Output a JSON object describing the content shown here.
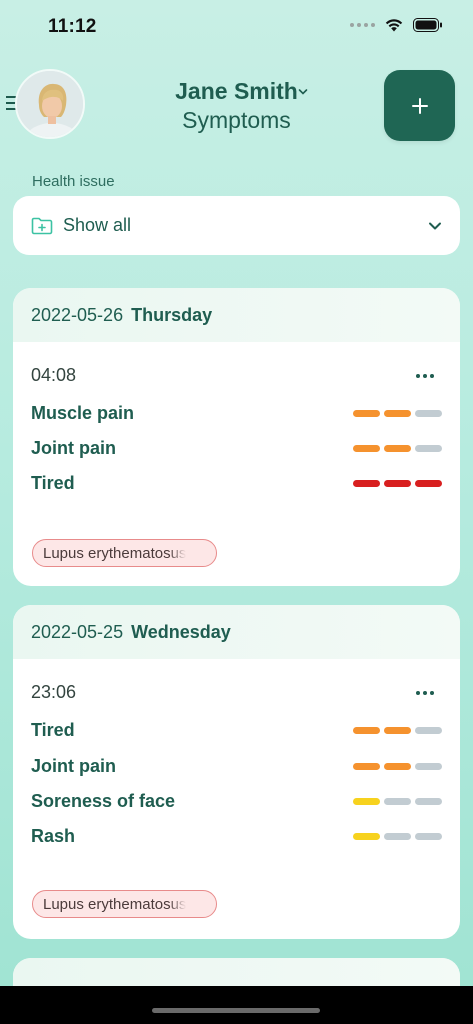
{
  "status_bar": {
    "time": "11:12"
  },
  "header": {
    "name": "Jane Smith",
    "subtitle": "Symptoms",
    "add_label": "+"
  },
  "filter": {
    "label": "Health issue",
    "value": "Show all"
  },
  "colors": {
    "moderate": "#f5922e",
    "severe": "#d81f1f",
    "mild": "#f7d21e",
    "empty": "#c2ccd2",
    "accent": "#1f6654"
  },
  "days": [
    {
      "date": "2022-05-26",
      "weekday": "Thursday",
      "entry": {
        "time": "04:08",
        "symptoms": [
          {
            "name": "Muscle pain",
            "severity": [
              "moderate",
              "moderate",
              "empty"
            ]
          },
          {
            "name": "Joint pain",
            "severity": [
              "moderate",
              "moderate",
              "empty"
            ]
          },
          {
            "name": "Tired",
            "severity": [
              "severe",
              "severe",
              "severe"
            ]
          }
        ],
        "tag": "Lupus erythematosus"
      }
    },
    {
      "date": "2022-05-25",
      "weekday": "Wednesday",
      "entry": {
        "time": "23:06",
        "symptoms": [
          {
            "name": "Tired",
            "severity": [
              "moderate",
              "moderate",
              "empty"
            ]
          },
          {
            "name": "Joint pain",
            "severity": [
              "moderate",
              "moderate",
              "empty"
            ]
          },
          {
            "name": "Soreness of face",
            "severity": [
              "mild",
              "empty",
              "empty"
            ]
          },
          {
            "name": "Rash",
            "severity": [
              "mild",
              "empty",
              "empty"
            ]
          }
        ],
        "tag": "Lupus erythematosus"
      }
    }
  ]
}
